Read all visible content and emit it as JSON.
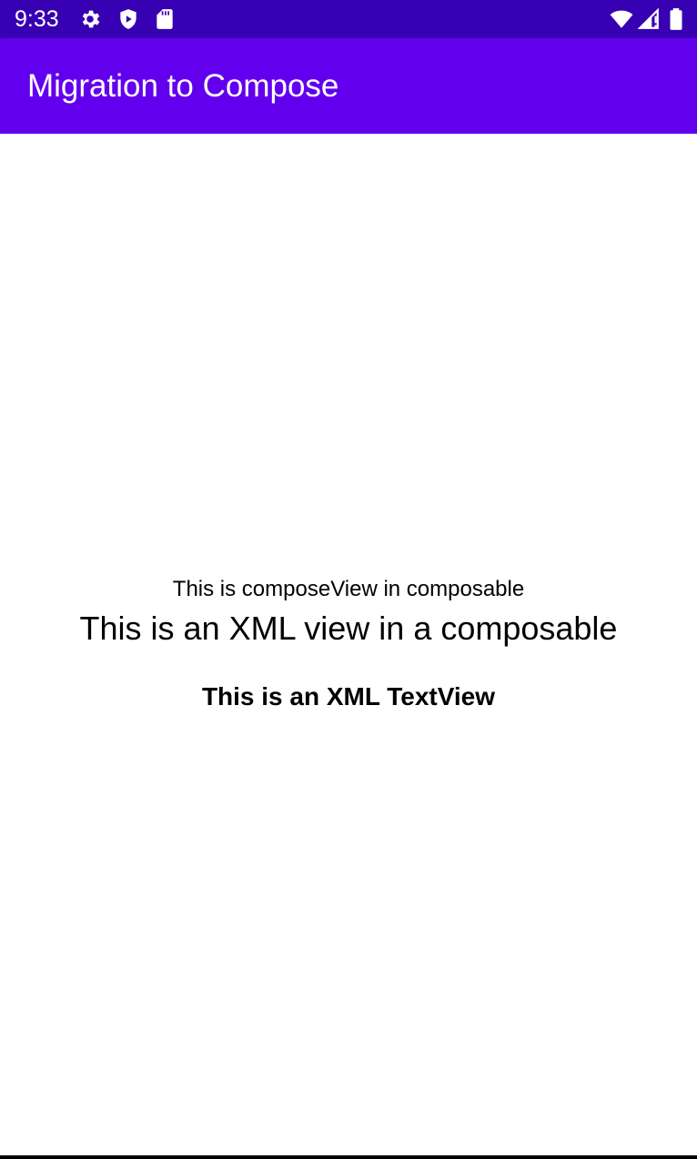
{
  "status_bar": {
    "time": "9:33",
    "left_icons": [
      "gear-icon",
      "shield-play-icon",
      "sd-card-icon"
    ],
    "right_icons": [
      "wifi-icon",
      "signal-icon",
      "battery-icon"
    ],
    "color": "#3700b3"
  },
  "app_bar": {
    "title": "Migration to Compose",
    "color": "#6200ee"
  },
  "content": {
    "compose_text": "This is composeView in composable",
    "xml_view_text": "This is an XML view in a composable",
    "xml_textview_text": "This is an XML TextView"
  }
}
